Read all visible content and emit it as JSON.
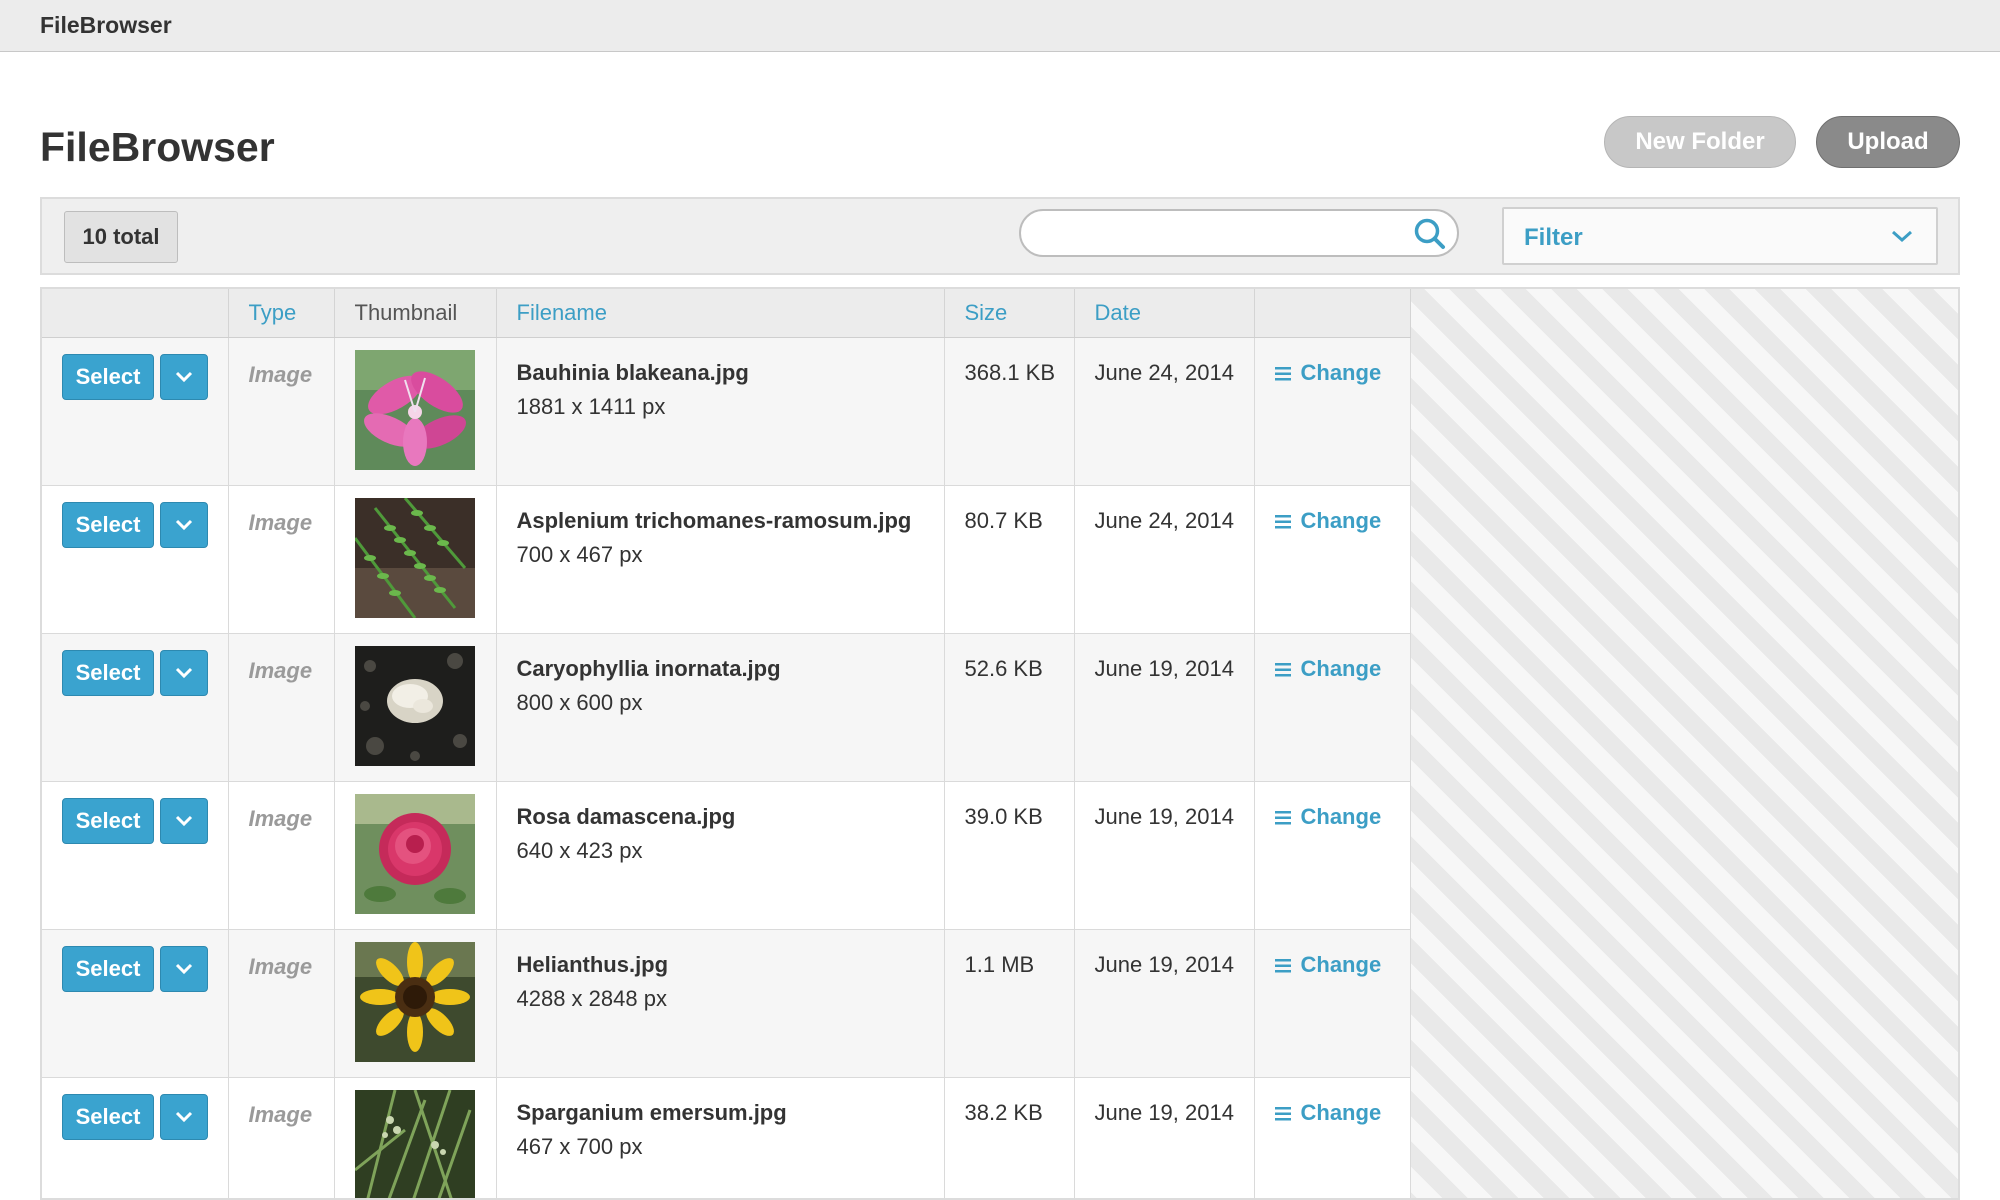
{
  "app": {
    "title": "FileBrowser"
  },
  "page": {
    "title": "FileBrowser",
    "new_folder_label": "New Folder",
    "upload_label": "Upload"
  },
  "toolbar": {
    "total_label": "10 total",
    "search_value": "",
    "search_icon": "search-icon",
    "filter_label": "Filter"
  },
  "table": {
    "columns": [
      "",
      "Type",
      "Thumbnail",
      "Filename",
      "Size",
      "Date",
      ""
    ],
    "rows": [
      {
        "select_label": "Select",
        "type": "Image",
        "thumb": "pink-orchid-flower",
        "filename": "Bauhinia blakeana.jpg",
        "dimensions": "1881 x 1411 px",
        "size": "368.1 KB",
        "date": "June 24, 2014",
        "action_label": "Change"
      },
      {
        "select_label": "Select",
        "type": "Image",
        "thumb": "green-fern",
        "filename": "Asplenium trichomanes-ramosum.jpg",
        "dimensions": "700 x 467 px",
        "size": "80.7 KB",
        "date": "June 24, 2014",
        "action_label": "Change"
      },
      {
        "select_label": "Select",
        "type": "Image",
        "thumb": "white-coral",
        "filename": "Caryophyllia inornata.jpg",
        "dimensions": "800 x 600 px",
        "size": "52.6 KB",
        "date": "June 19, 2014",
        "action_label": "Change"
      },
      {
        "select_label": "Select",
        "type": "Image",
        "thumb": "pink-rose",
        "filename": "Rosa damascena.jpg",
        "dimensions": "640 x 423 px",
        "size": "39.0 KB",
        "date": "June 19, 2014",
        "action_label": "Change"
      },
      {
        "select_label": "Select",
        "type": "Image",
        "thumb": "sunflower",
        "filename": "Helianthus.jpg",
        "dimensions": "4288 x 2848 px",
        "size": "1.1 MB",
        "date": "June 19, 2014",
        "action_label": "Change"
      },
      {
        "select_label": "Select",
        "type": "Image",
        "thumb": "green-grass-plant",
        "filename": "Sparganium emersum.jpg",
        "dimensions": "467 x 700 px",
        "size": "38.2 KB",
        "date": "June 19, 2014",
        "action_label": "Change"
      }
    ]
  },
  "colors": {
    "accent": "#3aa3cf",
    "link": "#3c9ec5",
    "new_folder_button": "#c8c8c8",
    "upload_button": "#8a8a8a"
  }
}
